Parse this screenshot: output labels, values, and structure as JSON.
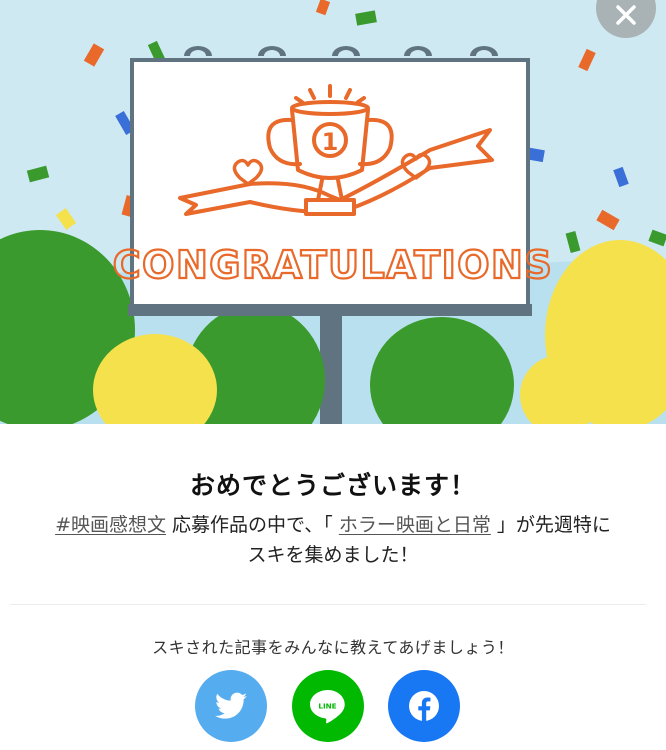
{
  "dialog": {
    "banner_text": "CONGRATULATIONS",
    "trophy_rank": "1",
    "title": "おめでとうございます！",
    "message": {
      "hashtag": "#映画感想文",
      "middle": " 応募作品の中で、「 ",
      "article_link": "ホラー映画と日常",
      "end": " 」が先週特に",
      "line2": "スキを集めました！"
    },
    "share_prompt": "スキされた記事をみんなに教えてあげましょう！",
    "share_buttons": [
      {
        "service": "twitter",
        "icon": "twitter-bird-icon",
        "color": "#55acee"
      },
      {
        "service": "line",
        "icon": "line-icon",
        "label": "LINE",
        "color": "#00b900"
      },
      {
        "service": "facebook",
        "icon": "facebook-icon",
        "color": "#1877f2"
      }
    ]
  },
  "colors": {
    "sky": "#cfe9f2",
    "orange": "#e8692a",
    "tree_green": "#3b9a2e",
    "tree_yellow": "#f5e14b",
    "board_frame": "#5f7480"
  }
}
